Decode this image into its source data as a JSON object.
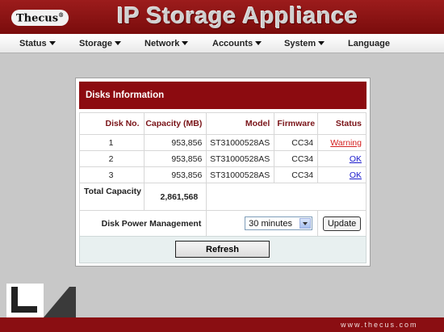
{
  "header": {
    "brand": "Thecus",
    "title": "IP Storage Appliance"
  },
  "nav": [
    {
      "label": "Status",
      "has_caret": true
    },
    {
      "label": "Storage",
      "has_caret": true
    },
    {
      "label": "Network",
      "has_caret": true
    },
    {
      "label": "Accounts",
      "has_caret": true
    },
    {
      "label": "System",
      "has_caret": true
    },
    {
      "label": "Language",
      "has_caret": false
    }
  ],
  "panel": {
    "title": "Disks Information",
    "columns": [
      "Disk No.",
      "Capacity (MB)",
      "Model",
      "Firmware",
      "Status"
    ],
    "rows": [
      {
        "disk": "1",
        "capacity": "953,856",
        "model": "ST31000528AS",
        "firmware": "CC34",
        "status": "Warning"
      },
      {
        "disk": "2",
        "capacity": "953,856",
        "model": "ST31000528AS",
        "firmware": "CC34",
        "status": "OK"
      },
      {
        "disk": "3",
        "capacity": "953,856",
        "model": "ST31000528AS",
        "firmware": "CC34",
        "status": "OK"
      }
    ],
    "total_label": "Total Capacity",
    "total_value": "2,861,568",
    "power_label": "Disk Power Management",
    "power_value": "30 minutes",
    "update_label": "Update",
    "refresh_label": "Refresh"
  },
  "footer": {
    "site": "www.thecus.com"
  },
  "colors": {
    "brand_red": "#8c0b10",
    "warning": "#d42020",
    "link": "#1a1acc"
  }
}
